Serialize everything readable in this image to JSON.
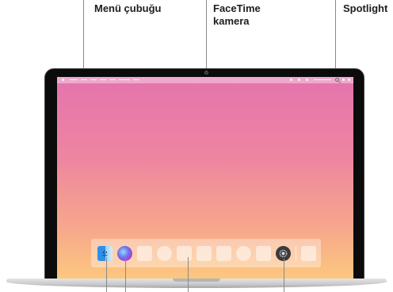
{
  "callouts": {
    "menu_bar": "Menü çubuğu",
    "facetime_line1": "FaceTime",
    "facetime_line2": "kamera",
    "spotlight": "Spotlight"
  },
  "colors": {
    "screen_top": "#e474ae",
    "screen_bottom": "#fcc97e",
    "bezel": "#0b0b0c",
    "leader_line": "#8a8a8a"
  },
  "dock_icons": [
    "finder-icon",
    "siri-icon",
    "app-placeholder",
    "system-preferences-icon"
  ]
}
